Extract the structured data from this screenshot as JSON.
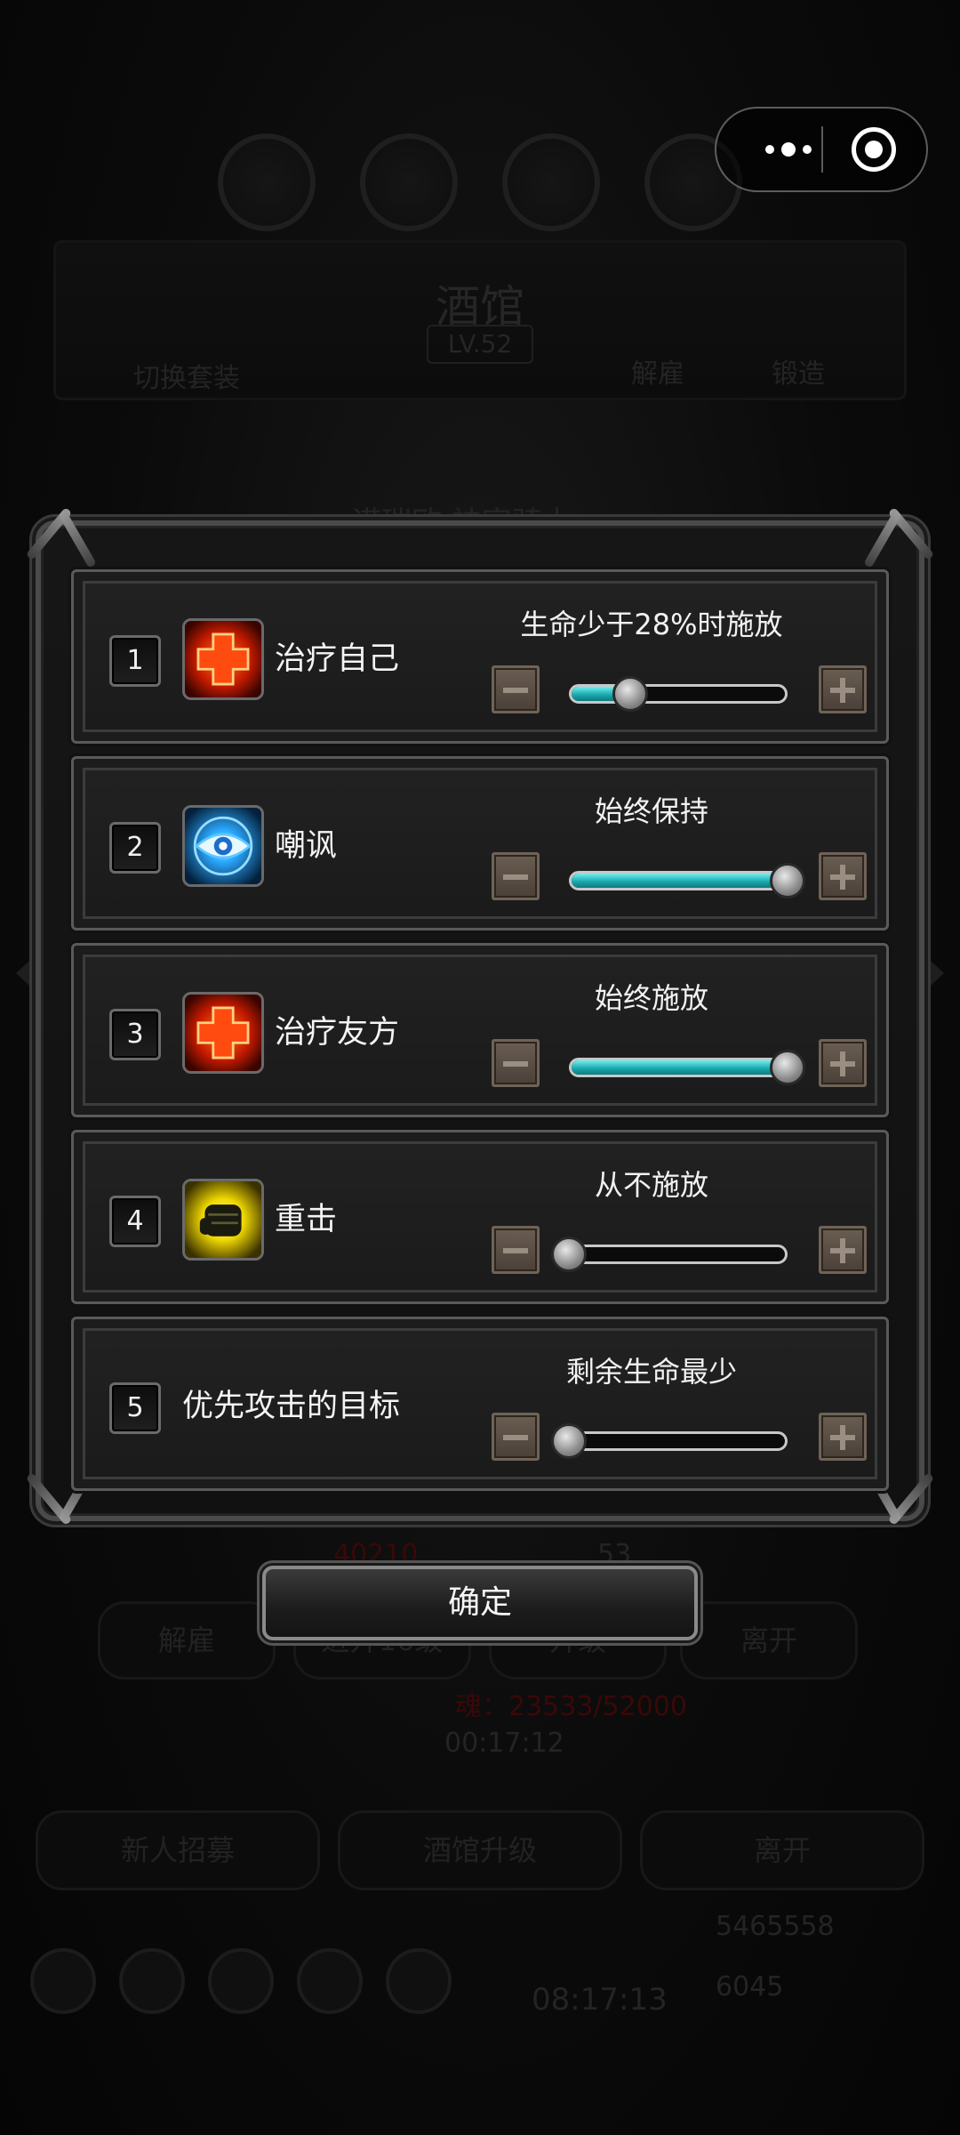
{
  "background": {
    "title": "酒馆",
    "level": "LV.52",
    "tabs": [
      "切换套装",
      "解雇",
      "锻造"
    ],
    "hero_name": "诺瑞欧·神官骑士",
    "hp": "40210",
    "energy": "53",
    "actions": [
      "解雇",
      "进升16级",
      "升级",
      "离开"
    ],
    "soul": "魂：23533/52000",
    "timer": "00:17:12",
    "bottom_buttons": [
      "新人招募",
      "酒馆升级",
      "离开"
    ],
    "clock": "08:17:13",
    "gold": "5465558",
    "gems": "6045"
  },
  "dialog": {
    "rows": [
      {
        "number": "1",
        "icon": "heal-cross-icon",
        "name": "治疗自己",
        "condition": "生命少于28%时施放",
        "level": 0.28
      },
      {
        "number": "2",
        "icon": "eye-taunt-icon",
        "name": "嘲讽",
        "condition": "始终保持",
        "level": 1.0
      },
      {
        "number": "3",
        "icon": "heal-cross-icon",
        "name": "治疗友方",
        "condition": "始终施放",
        "level": 1.0
      },
      {
        "number": "4",
        "icon": "fist-icon",
        "name": "重击",
        "condition": "从不施放",
        "level": 0.0
      },
      {
        "number": "5",
        "icon": "",
        "name": "优先攻击的目标",
        "condition": "剩余生命最少",
        "level": 0.0
      }
    ],
    "confirm_label": "确定"
  },
  "colors": {
    "slider_fill": "#17a4a8",
    "panel": "#1c1c1c",
    "heal_icon": "#ff3a00",
    "taunt_icon": "#2aa8ff",
    "fist_icon": "#f0d800"
  }
}
